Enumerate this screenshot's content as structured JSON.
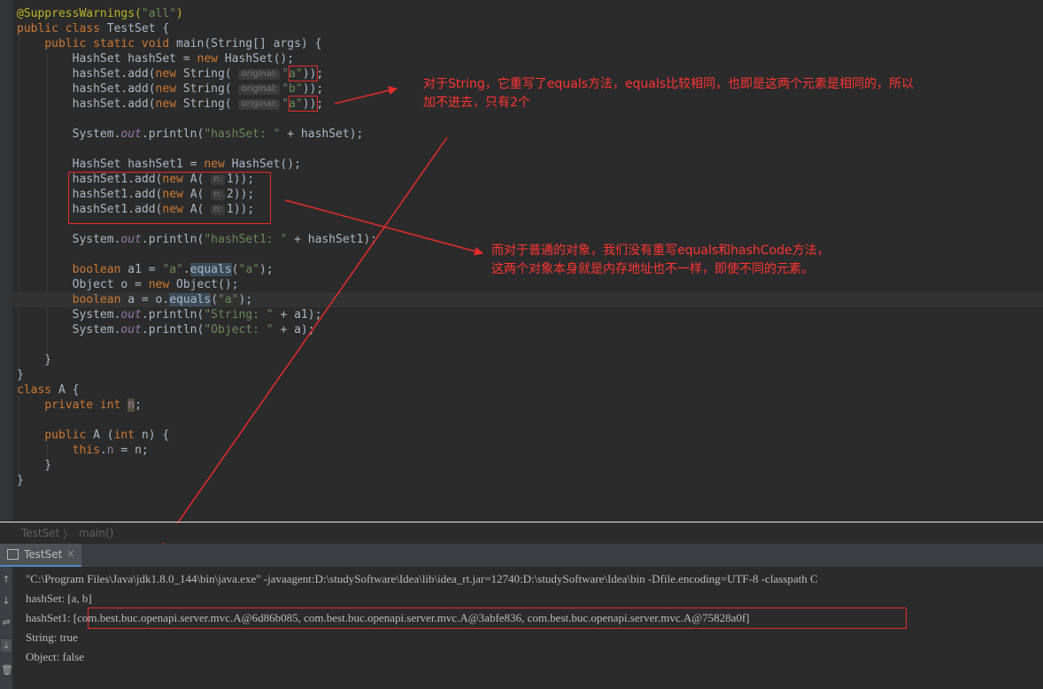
{
  "editor": {
    "lines": [
      "@SuppressWarnings(\"all\")",
      "public class TestSet {",
      "    public static void main(String[] args) {",
      "        HashSet hashSet = new HashSet();",
      "        hashSet.add(new String( original: \"a\"));",
      "        hashSet.add(new String( original: \"b\"));",
      "        hashSet.add(new String( original: \"a\"));",
      "",
      "        System.out.println(\"hashSet: \" + hashSet);",
      "",
      "        HashSet hashSet1 = new HashSet();",
      "        hashSet1.add(new A( n: 1));",
      "        hashSet1.add(new A( n: 2));",
      "        hashSet1.add(new A( n: 1));",
      "",
      "        System.out.println(\"hashSet1: \" + hashSet1);",
      "",
      "        boolean a1 = \"a\".equals(\"a\");",
      "        Object o = new Object();",
      "        boolean a = o.equals(\"a\");",
      "        System.out.println(\"String: \" + a1);",
      "        System.out.println(\"Object: \" + a);",
      "",
      "    }",
      "}",
      "class A {",
      "    private int n;",
      "",
      "    public A (int n) {",
      "        this.n = n;",
      "    }",
      "}"
    ],
    "hints": {
      "original": "original:",
      "n": "n:"
    }
  },
  "annotations": {
    "note1": "对于String，它重写了equals方法，equals比较相同，也即是这两个元素是相同的，所以\n加不进去，只有2个",
    "note2": "而对于普通的对象，我们没有重写equals和hashCode方法，\n这两个对象本身就是内存地址也不一样，即使不同的元素。",
    "arrow_color": "#e52b2b"
  },
  "breadcrumb": {
    "class_name": "TestSet",
    "method_name": "main()",
    "separator": "〉"
  },
  "run_panel": {
    "tab_label": "TestSet",
    "close": "×"
  },
  "toolstrip": [
    "↑",
    "↓",
    "⇌",
    "⤓",
    "🗑"
  ],
  "console": {
    "lines": [
      "\"C:\\Program Files\\Java\\jdk1.8.0_144\\bin\\java.exe\" -javaagent:D:\\studySoftware\\Idea\\lib\\idea_rt.jar=12740:D:\\studySoftware\\Idea\\bin -Dfile.encoding=UTF-8 -classpath C",
      "hashSet: [a, b]",
      "hashSet1: [com.best.buc.openapi.server.mvc.A@6d86b085, com.best.buc.openapi.server.mvc.A@3abfe836, com.best.buc.openapi.server.mvc.A@75828a0f]",
      "String: true",
      "Object: false"
    ]
  },
  "colors": {
    "keyword": "#cc7832",
    "string": "#6a8759",
    "annotation": "#bbb529",
    "field": "#9876aa",
    "text": "#a9b7c6",
    "console": "#bbbbbb",
    "red": "#e52b2b"
  }
}
